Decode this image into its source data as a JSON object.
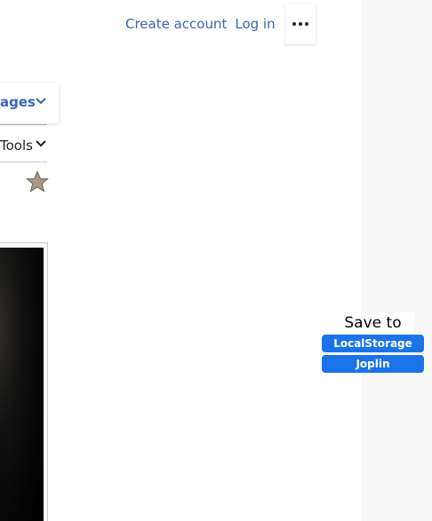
{
  "header": {
    "create_account": "Create account",
    "log_in": "Log in",
    "more_icon": "ellipsis-icon"
  },
  "sidebar": {
    "languages_label": "ages",
    "tools_label": "Tools"
  },
  "icons": {
    "chevron": "chevron-down-icon",
    "star": "star-icon"
  },
  "save_panel": {
    "title": "Save to",
    "buttons": [
      "LocalStorage",
      "Joplin"
    ]
  },
  "colors": {
    "link": "#3a64b8",
    "save_button": "#1a73e8",
    "gutter": "#f7f8f7"
  }
}
